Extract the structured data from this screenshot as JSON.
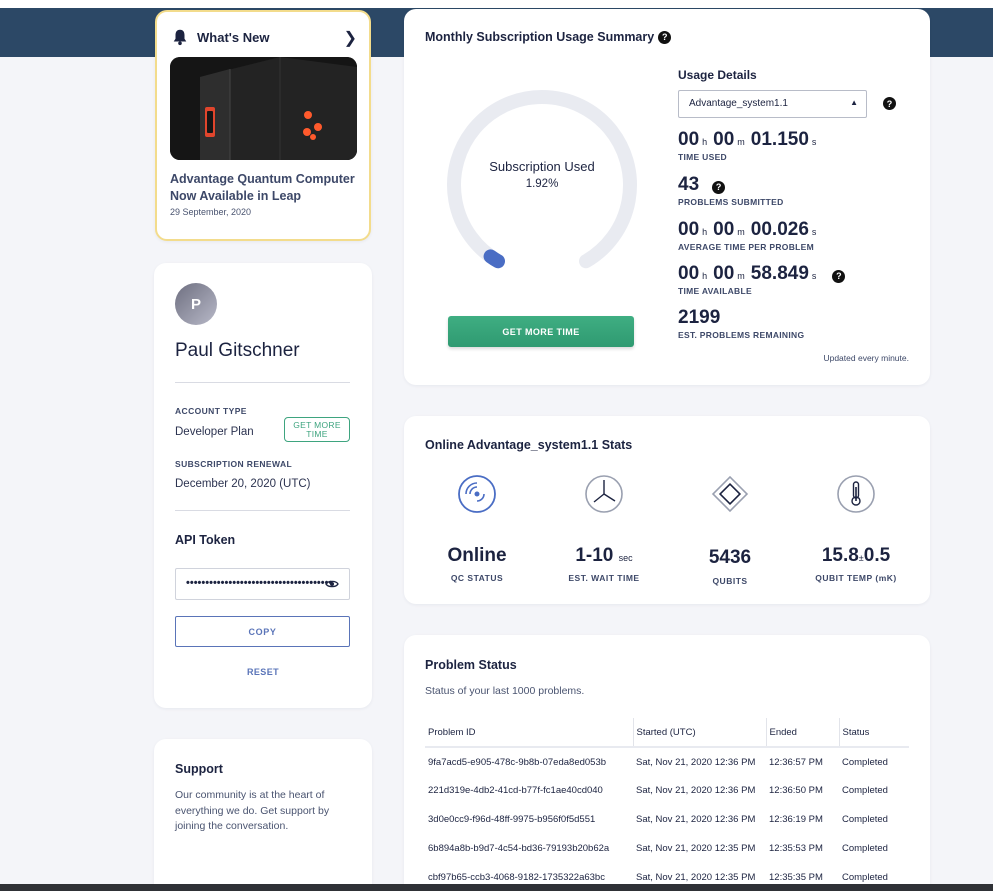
{
  "whats_new": {
    "title": "What's New",
    "headline": "Advantage Quantum Computer Now Available in Leap",
    "date": "29 September, 2020"
  },
  "profile": {
    "avatar_initial": "P",
    "name": "Paul Gitschner",
    "account_type_label": "ACCOUNT TYPE",
    "account_type_value": "Developer Plan",
    "get_more_time_label": "GET MORE TIME",
    "renewal_label": "SUBSCRIPTION RENEWAL",
    "renewal_value": "December 20, 2020 (UTC)",
    "api_token_title": "API Token",
    "api_token_value": "••••••••••••••••••••••••••••••••••••••",
    "copy_label": "COPY",
    "reset_label": "RESET"
  },
  "support": {
    "title": "Support",
    "text": "Our community is at the heart of everything we do. Get support by joining the conversation."
  },
  "usage": {
    "title": "Monthly Subscription Usage Summary",
    "gauge_label": "Subscription Used",
    "gauge_percent_text": "1.92%",
    "gauge_fraction": 0.0192,
    "get_more_time": "GET MORE TIME",
    "details_title": "Usage Details",
    "solver_selected": "Advantage_system1.1",
    "time_used": {
      "h": "00",
      "m": "00",
      "s": "01.150",
      "label": "TIME USED"
    },
    "problems_submitted": {
      "value": "43",
      "label": "PROBLEMS SUBMITTED"
    },
    "avg_time": {
      "h": "00",
      "m": "00",
      "s": "00.026",
      "label": "AVERAGE TIME PER PROBLEM"
    },
    "time_available": {
      "h": "00",
      "m": "00",
      "s": "58.849",
      "label": "TIME AVAILABLE"
    },
    "est_remaining": {
      "value": "2199",
      "label": "EST. PROBLEMS REMAINING"
    },
    "units": {
      "h": "h",
      "m": "m",
      "s": "s"
    },
    "updated_note": "Updated every minute."
  },
  "online_stats": {
    "title": "Online Advantage_system1.1 Stats",
    "status": {
      "value": "Online",
      "label": "QC STATUS"
    },
    "wait": {
      "value": "1-10",
      "unit": "sec",
      "label": "EST. WAIT TIME"
    },
    "qubits": {
      "value": "5436",
      "label": "QUBITS"
    },
    "temp": {
      "value": "15.8",
      "pm": "±",
      "err": "0.5",
      "label": "QUBIT TEMP (mK)"
    }
  },
  "problem_status": {
    "title": "Problem Status",
    "subtitle": "Status of your last 1000 problems.",
    "columns": [
      "Problem ID",
      "Started (UTC)",
      "Ended",
      "Status"
    ],
    "rows": [
      [
        "9fa7acd5-e905-478c-9b8b-07eda8ed053b",
        "Sat, Nov 21, 2020 12:36 PM",
        "12:36:57 PM",
        "Completed"
      ],
      [
        "221d319e-4db2-41cd-b77f-fc1ae40cd040",
        "Sat, Nov 21, 2020 12:36 PM",
        "12:36:50 PM",
        "Completed"
      ],
      [
        "3d0e0cc9-f96d-48ff-9975-b956f0f5d551",
        "Sat, Nov 21, 2020 12:36 PM",
        "12:36:19 PM",
        "Completed"
      ],
      [
        "6b894a8b-b9d7-4c54-bd36-79193b20b62a",
        "Sat, Nov 21, 2020 12:35 PM",
        "12:35:53 PM",
        "Completed"
      ],
      [
        "cbf97b65-ccb3-4068-9182-1735322a63bc",
        "Sat, Nov 21, 2020 12:35 PM",
        "12:35:35 PM",
        "Completed"
      ]
    ]
  },
  "colors": {
    "header": "#2c4866",
    "accent_green": "#3ea47f",
    "accent_blue": "#5a74b8",
    "gauge_track": "#e9ebf1",
    "gauge_fill": "#4a6dc4"
  }
}
